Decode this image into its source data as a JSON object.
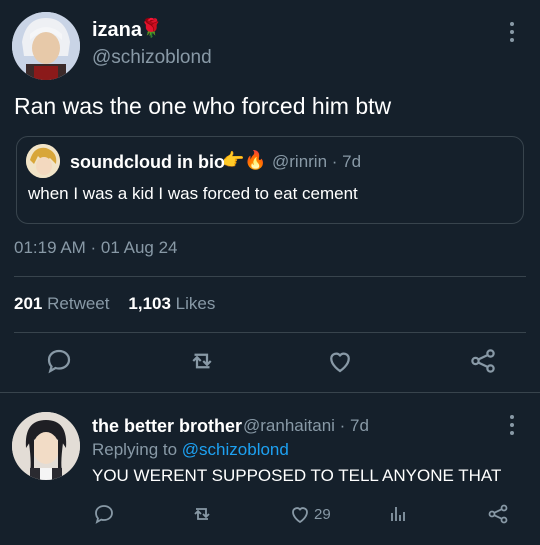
{
  "tweet": {
    "author_name": "izana",
    "author_handle": "@schizoblond",
    "text": "Ran was the one who forced him btw",
    "timestamp": "01:19 AM · 01 Aug 24"
  },
  "quote": {
    "author_name": "soundcloud in bio",
    "handle_time": "@rinrin · 7d",
    "text": "when I was a kid I was forced to eat cement"
  },
  "stats": {
    "retweets_count": "201",
    "retweets_label": "Retweet",
    "likes_count": "1,103",
    "likes_label": "Likes"
  },
  "reply": {
    "author_name": "the better brother",
    "handle_time": "@ranhaitani · 7d",
    "replying_prefix": "Replying to",
    "replying_handle": "@schizoblond",
    "text": "YOU WERENT SUPPOSED TO TELL ANYONE THAT",
    "like_count": "29"
  },
  "icons": {
    "name_decoration": "rose-icon",
    "quote_decoration": "pointing-hand-fire-icons",
    "actions": [
      "reply-icon",
      "retweet-icon",
      "like-icon",
      "share-icon"
    ],
    "reply_actions": [
      "reply-icon",
      "retweet-icon",
      "like-icon",
      "stats-icon",
      "share-icon"
    ]
  },
  "colors": {
    "background": "#15202b",
    "muted": "#8899a6",
    "link": "#1da1f2",
    "divider": "#38444d"
  }
}
